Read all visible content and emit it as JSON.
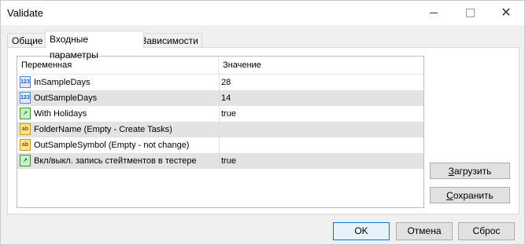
{
  "window": {
    "title": "Validate"
  },
  "tabs": [
    {
      "label": "Общие"
    },
    {
      "label": "Входные параметры"
    },
    {
      "label": "Зависимости"
    }
  ],
  "grid": {
    "headers": [
      "Переменная",
      "Значение"
    ],
    "rows": [
      {
        "icon": "123",
        "icon_type": "number-icon",
        "name": "InSampleDays",
        "value": "28"
      },
      {
        "icon": "123",
        "icon_type": "number-icon",
        "name": "OutSampleDays",
        "value": "14"
      },
      {
        "icon": "↗",
        "icon_type": "bool-icon",
        "name": "With Holidays",
        "value": "true"
      },
      {
        "icon": "ab",
        "icon_type": "string-icon",
        "name": "FolderName (Empty - Create Tasks)",
        "value": ""
      },
      {
        "icon": "ab",
        "icon_type": "string-icon",
        "name": "OutSampleSymbol (Empty - not change)",
        "value": ""
      },
      {
        "icon": "↗",
        "icon_type": "bool-icon",
        "name": "Вкл/выкл. запись стейтментов в тестере",
        "value": "true"
      }
    ]
  },
  "side_buttons": {
    "load_pre": "",
    "load_u": "З",
    "load_rest": "агрузить",
    "save_pre": "",
    "save_u": "С",
    "save_rest": "охранить"
  },
  "buttons": {
    "ok": "OK",
    "cancel": "Отмена",
    "reset": "Сброс"
  },
  "titlebar_icons": {
    "minimize": "minimize-icon",
    "maximize": "maximize-icon",
    "close": "close-icon"
  }
}
